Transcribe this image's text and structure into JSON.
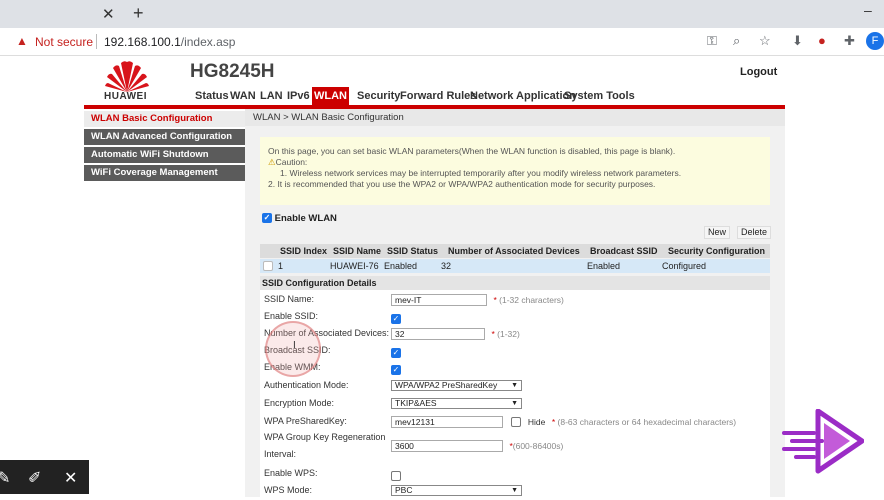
{
  "browser": {
    "security_label": "Not secure",
    "url_host": "192.168.100.1",
    "url_path": "/index.asp",
    "profile_initial": "F"
  },
  "header": {
    "brand": "HUAWEI",
    "model": "HG8245H",
    "logout_label": "Logout",
    "nav": [
      "Status",
      "WAN",
      "LAN",
      "IPv6",
      "WLAN",
      "Security",
      "Forward Rules",
      "Network Application",
      "System Tools"
    ],
    "active_nav": "WLAN"
  },
  "sidebar": {
    "items": [
      {
        "label": "WLAN Basic Configuration",
        "active": true
      },
      {
        "label": "WLAN Advanced Configuration",
        "active": false
      },
      {
        "label": "Automatic WiFi Shutdown",
        "active": false
      },
      {
        "label": "WiFi Coverage Management",
        "active": false
      }
    ]
  },
  "content": {
    "breadcrumb": "WLAN > WLAN Basic Configuration",
    "note": {
      "line1": "On this page, you can set basic WLAN parameters(When the WLAN function is disabled, this page is blank).",
      "caution": "Caution:",
      "line2": "1. Wireless network services may be interrupted temporarily after you modify wireless network parameters.",
      "line3": "2. It is recommended that you use the WPA2 or WPA/WPA2 authentication mode for security purposes."
    },
    "enable_wlan_label": "Enable WLAN",
    "new_button": "New",
    "delete_button": "Delete",
    "table": {
      "headers": [
        "SSID Index",
        "SSID Name",
        "SSID Status",
        "Number of Associated Devices",
        "Broadcast SSID",
        "Security Configuration"
      ],
      "row": [
        "1",
        "HUAWEI-76",
        "Enabled",
        "32",
        "Enabled",
        "Configured"
      ]
    },
    "config_title": "SSID Configuration Details",
    "config": {
      "ssid_name_label": "SSID Name:",
      "ssid_name_value": "mev-IT",
      "ssid_name_hint": "(1-32 characters)",
      "enable_ssid_label": "Enable SSID:",
      "assoc_devices_label": "Number of Associated Devices:",
      "assoc_devices_value": "32",
      "assoc_devices_hint": "(1-32)",
      "broadcast_ssid_label": "Broadcast SSID:",
      "enable_wmm_label": "Enable WMM:",
      "auth_mode_label": "Authentication Mode:",
      "auth_mode_value": "WPA/WPA2 PreSharedKey",
      "encryption_label": "Encryption Mode:",
      "encryption_value": "TKIP&AES",
      "psk_label": "WPA PreSharedKey:",
      "psk_value": "mev12131",
      "hide_label": "Hide",
      "psk_hint": "(8-63 characters or 64 hexadecimal characters)",
      "group_key_label_1": "WPA Group Key Regeneration",
      "group_key_label_2": "Interval:",
      "group_key_value": "3600",
      "group_key_hint": "(600-86400s)",
      "enable_wps_label": "Enable WPS:",
      "wps_mode_label": "WPS Mode:",
      "wps_mode_value": "PBC"
    }
  },
  "colors": {
    "brand_red": "#cc0000",
    "sidebar_gray": "#5b5b5b",
    "checkbox_blue": "#1a73e8"
  }
}
